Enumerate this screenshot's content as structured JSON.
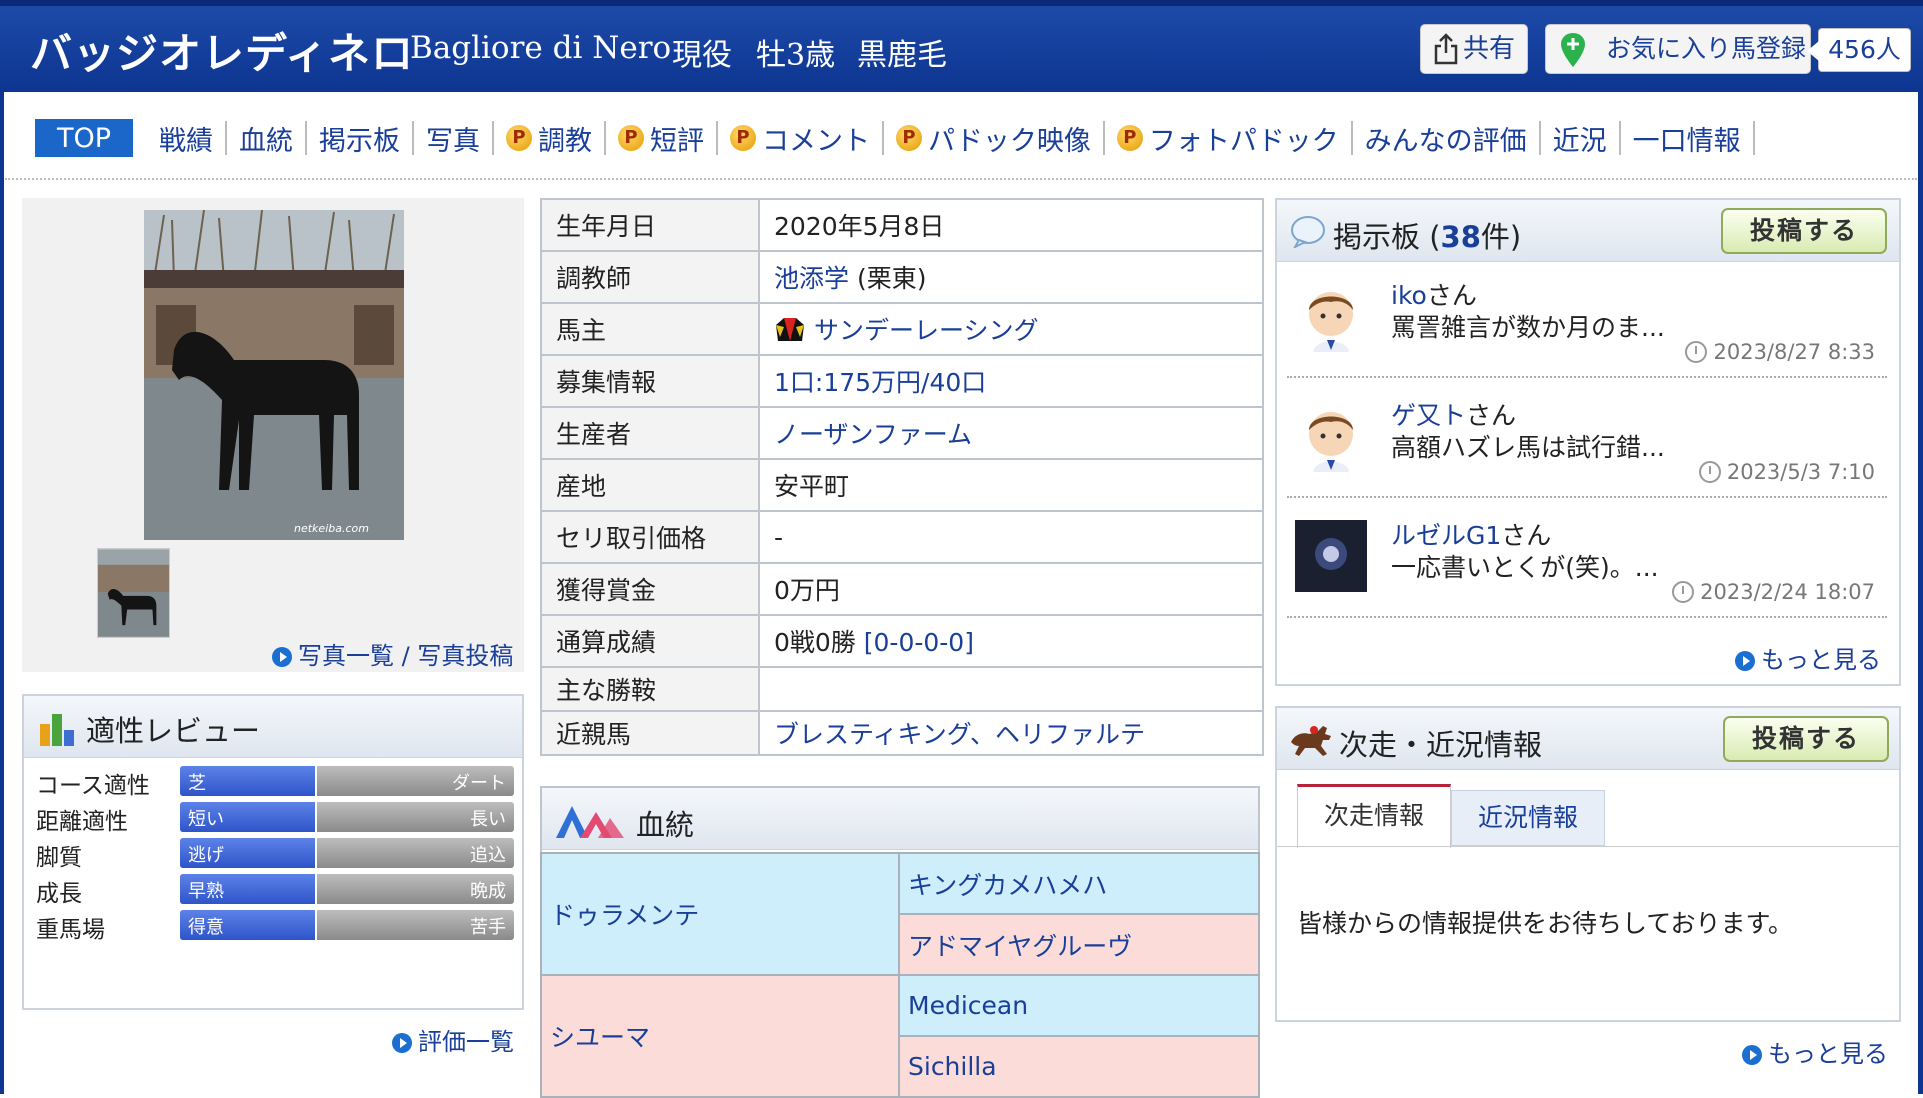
{
  "header": {
    "horse_name": "バッジオレディネロ",
    "english_name": "Bagliore di Nero",
    "status": "現役",
    "sex_age": "牡3歳",
    "coat": "黒鹿毛",
    "share_label": "共有",
    "favorite_label": "お気に入り馬登録",
    "favorite_count": "456人"
  },
  "nav": {
    "items": [
      {
        "label": "TOP",
        "active": true,
        "premium": false
      },
      {
        "label": "戦績",
        "premium": false
      },
      {
        "label": "血統",
        "premium": false
      },
      {
        "label": "掲示板",
        "premium": false
      },
      {
        "label": "写真",
        "premium": false
      },
      {
        "label": "調教",
        "premium": true
      },
      {
        "label": "短評",
        "premium": true
      },
      {
        "label": "コメント",
        "premium": true
      },
      {
        "label": "パドック映像",
        "premium": true
      },
      {
        "label": "フォトパドック",
        "premium": true
      },
      {
        "label": "みんなの評価",
        "premium": false
      },
      {
        "label": "近況",
        "premium": false
      },
      {
        "label": "一口情報",
        "premium": false
      }
    ],
    "premium_badge": "P"
  },
  "photo": {
    "watermark": "netkeiba.com",
    "list_link": "写真一覧",
    "separator": "/",
    "post_link": "写真投稿"
  },
  "aptitude": {
    "title": "適性レビュー",
    "rows": [
      {
        "label": "コース適性",
        "left": "芝",
        "right": "ダート",
        "value": 0.41
      },
      {
        "label": "距離適性",
        "left": "短い",
        "right": "長い",
        "value": 0.41
      },
      {
        "label": "脚質",
        "left": "逃げ",
        "right": "追込",
        "value": 0.41
      },
      {
        "label": "成長",
        "left": "早熟",
        "right": "晩成",
        "value": 0.41
      },
      {
        "label": "重馬場",
        "left": "得意",
        "right": "苦手",
        "value": 0.41
      }
    ],
    "more_link": "評価一覧"
  },
  "profile": {
    "birthdate_label": "生年月日",
    "birthdate": "2020年5月8日",
    "trainer_label": "調教師",
    "trainer": "池添学",
    "trainer_region": "(栗東)",
    "owner_label": "馬主",
    "owner": "サンデーレーシング",
    "recruit_label": "募集情報",
    "recruit": "1口:175万円/40口",
    "breeder_label": "生産者",
    "breeder": "ノーザンファーム",
    "origin_label": "産地",
    "origin": "安平町",
    "auction_label": "セリ取引価格",
    "auction": "-",
    "prize_label": "獲得賞金",
    "prize": "0万円",
    "record_label": "通算成績",
    "record": "0戦0勝",
    "record_detail": "[0-0-0-0]",
    "wins_label": "主な勝鞍",
    "wins": "",
    "relatives_label": "近親馬",
    "relatives": "ブレスティキング、ヘリファルテ"
  },
  "pedigree": {
    "title": "血統",
    "sire": "ドゥラメンテ",
    "sire_sire": "キングカメハメハ",
    "sire_dam": "アドマイヤグルーヴ",
    "dam": "シユーマ",
    "dam_sire": "Medicean",
    "dam_dam": "Sichilla"
  },
  "bbs": {
    "title_prefix": "掲示板 (",
    "count": "38",
    "title_suffix": "件)",
    "post_label": "投稿する",
    "comments": [
      {
        "user": "iko",
        "suffix": "さん",
        "text": "罵詈雑言が数か月のま...",
        "time": "2023/8/27 8:33"
      },
      {
        "user": "ゲ又ト",
        "suffix": "さん",
        "text": "高額ハズレ馬は試行錯...",
        "time": "2023/5/3 7:10"
      },
      {
        "user": "ルゼルG1",
        "suffix": "さん",
        "text": "一応書いとくが(笑)。...",
        "time": "2023/2/24 18:07"
      }
    ],
    "more_link": "もっと見る"
  },
  "next_race": {
    "title": "次走・近況情報",
    "post_label": "投稿する",
    "tab_next": "次走情報",
    "tab_recent": "近況情報",
    "message": "皆様からの情報提供をお待ちしております。",
    "more_link": "もっと見る"
  },
  "colors": {
    "header_blue": "#0d3591",
    "link_blue": "#1a3f99",
    "bar_blue": "#2e55c9",
    "pedigree_male": "#cdeefa",
    "pedigree_female": "#fbdcd9"
  }
}
